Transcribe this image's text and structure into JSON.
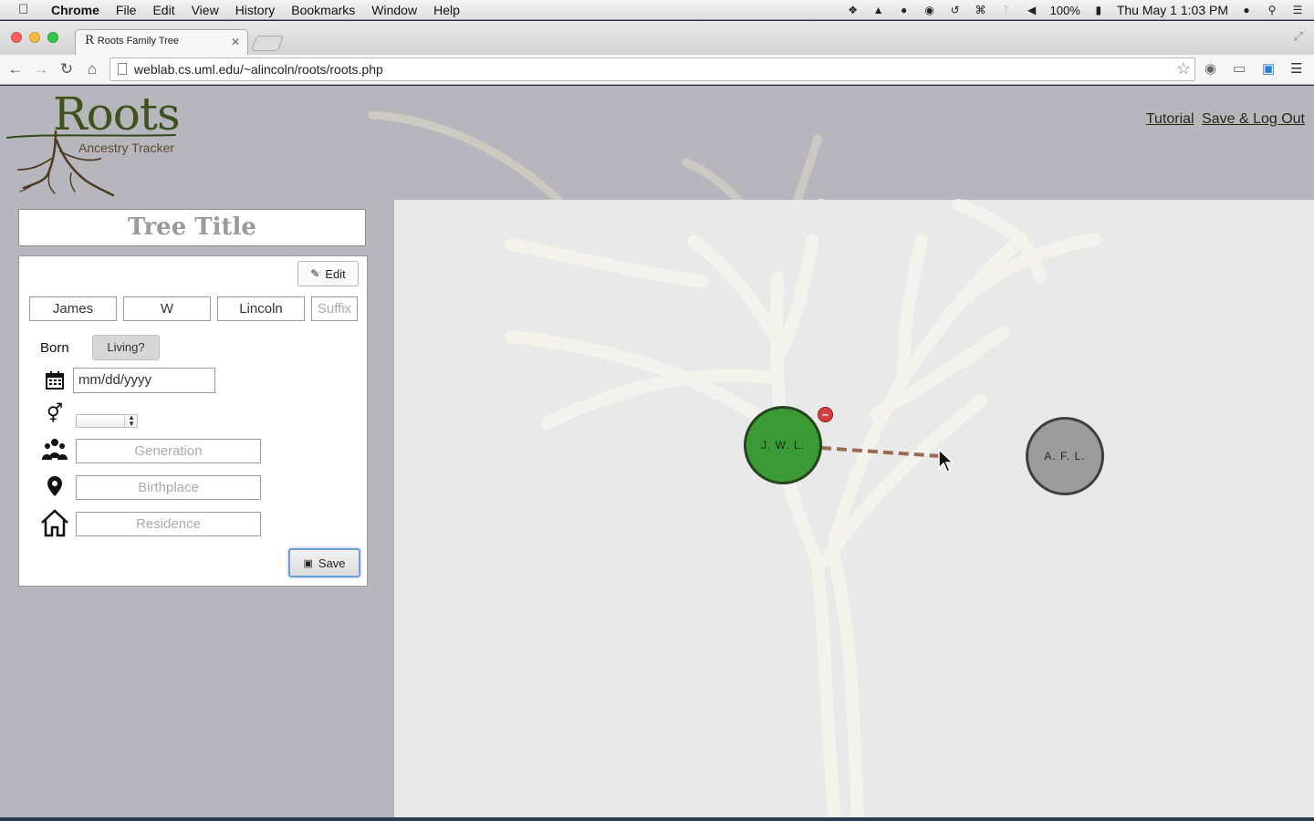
{
  "menubar": {
    "items": [
      "Chrome",
      "File",
      "Edit",
      "View",
      "History",
      "Bookmarks",
      "Window",
      "Help"
    ],
    "battery": "100%",
    "datetime": "Thu May 1  1:03 PM"
  },
  "browser": {
    "tab_title": "Roots Family Tree",
    "favicon": "R",
    "url": "weblab.cs.uml.edu/~alincoln/roots/roots.php"
  },
  "header": {
    "logo_title": "Roots",
    "logo_subtitle": "Ancestry Tracker",
    "tutorial_link": "Tutorial",
    "save_logout_link": "Save & Log Out"
  },
  "form": {
    "tree_title": "Tree Title",
    "edit_label": "Edit",
    "first_name": "James",
    "middle_name": "W",
    "last_name": "Lincoln",
    "suffix_placeholder": "Suffix",
    "born_label": "Born",
    "living_label": "Living?",
    "date_placeholder": "mm/dd/yyyy",
    "generation_placeholder": "Generation",
    "birthplace_placeholder": "Birthplace",
    "residence_placeholder": "Residence",
    "save_label": "Save"
  },
  "canvas": {
    "nodes": [
      {
        "initials": "J. W. L.",
        "state": "selected",
        "color": "#3a9a35"
      },
      {
        "initials": "A. F. L.",
        "state": "default",
        "color": "#9c9c9c"
      }
    ],
    "remove_badge": "–",
    "link_color": "#9a6a55"
  }
}
